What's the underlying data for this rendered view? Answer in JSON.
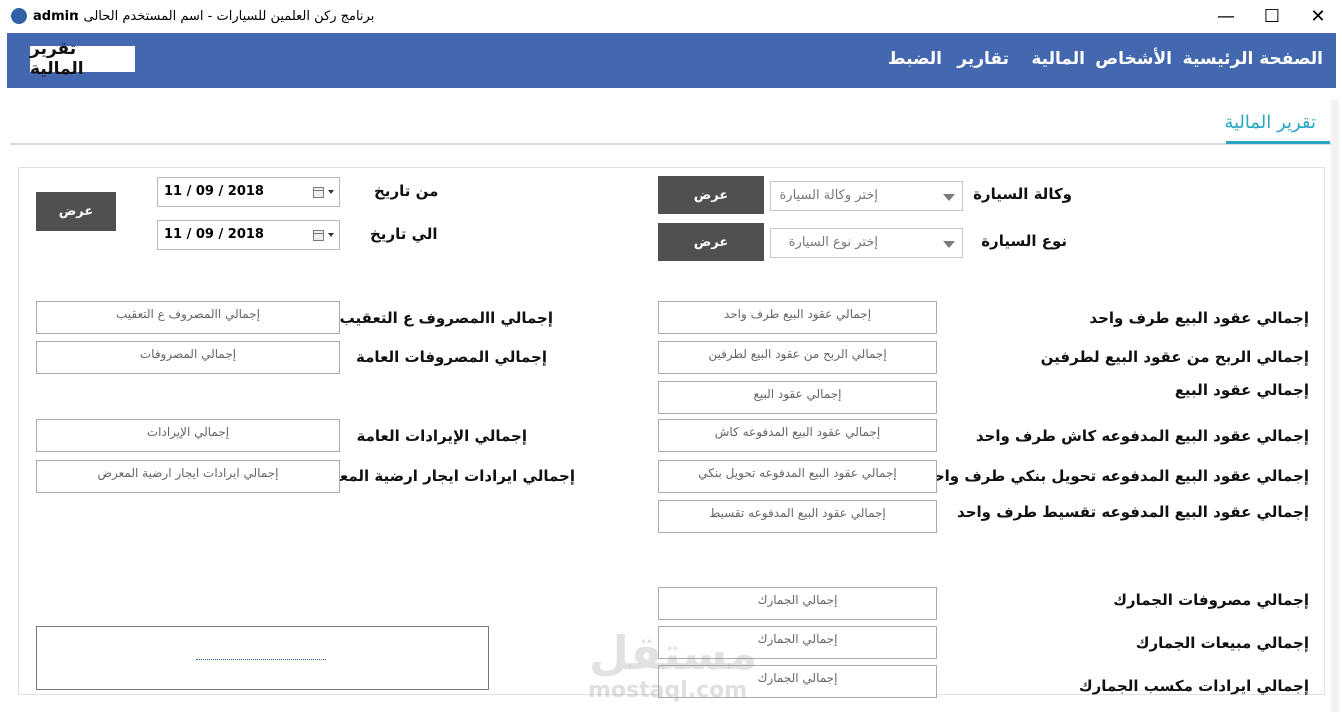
{
  "window": {
    "user": "admin",
    "title": "برنامج  ركن العلمين للسيارات  -  اسم المستخدم الحالى  :",
    "controls": {
      "minimize": "—",
      "maximize": "☐",
      "close": "✕"
    }
  },
  "nav": {
    "items": [
      "الصفحة الرئيسية",
      "الأشخاص",
      "المالية",
      "تقارير",
      "الضبط"
    ],
    "current_badge": "تقرير المالية"
  },
  "page": {
    "title": "تقرير المالية"
  },
  "filters": {
    "agency_label": "وكالة السيارة",
    "agency_placeholder": "إختر وكالة السيارة",
    "type_label": "نوع السيارة",
    "type_placeholder": "إختر نوع السيارة",
    "show_button": "عرض",
    "from_label": "من تاريخ",
    "to_label": "الي تاريخ",
    "from_date": "11 / 09 / 2018",
    "to_date": "11 / 09 / 2018"
  },
  "right_rows": [
    {
      "label": "إجمالي عقود البيع طرف واحد",
      "placeholder": "إجمالي عقود البيع طرف واحد"
    },
    {
      "label": "إجمالي الربح من عقود البيع لطرفين",
      "placeholder": "إجمالي الربح من عقود البيع لطرفين"
    },
    {
      "label": "إجمالي عقود البيع",
      "placeholder": "إجمالي عقود البيع"
    },
    {
      "label": "إجمالي عقود البيع المدفوعه كاش طرف واحد",
      "placeholder": "إجمالي عقود البيع المدفوعه كاش"
    },
    {
      "label": "إجمالي عقود البيع المدفوعه تحويل بنكي طرف واحد",
      "placeholder": "إجمالي عقود البيع المدفوعه تحويل بنكي"
    },
    {
      "label": "إجمالي عقود البيع المدفوعه تقسيط  طرف واحد",
      "placeholder": "إجمالي عقود البيع المدفوعه تقسيط"
    },
    {
      "label": "إجمالي مصروفات الجمارك",
      "placeholder": "إجمالي الجمارك"
    },
    {
      "label": "إجمالي مبيعات الجمارك",
      "placeholder": "إجمالي الجمارك"
    },
    {
      "label": "إجمالي ايرادات مكسب الجمارك",
      "placeholder": "إجمالي الجمارك"
    }
  ],
  "left_rows": [
    {
      "label": "إجمالي االمصروف ع التعقيب",
      "placeholder": "إجمالي االمصروف ع التعقيب"
    },
    {
      "label": "إجمالي المصروفات العامة",
      "placeholder": "إجمالي المصروفات"
    },
    {
      "label": "إجمالي الإيرادات العامة",
      "placeholder": "إجمالي الإيرادات"
    },
    {
      "label": "إجمالي ايرادات ايجار ارضية المعرض",
      "placeholder": "إجمالي ايرادات ايجار ارضية المعرض"
    }
  ],
  "watermark": {
    "main": "مستقل",
    "sub": "mostaql.com"
  },
  "colors": {
    "nav_bg": "#4468b0",
    "accent": "#29a6c6",
    "button_bg": "#505050"
  }
}
